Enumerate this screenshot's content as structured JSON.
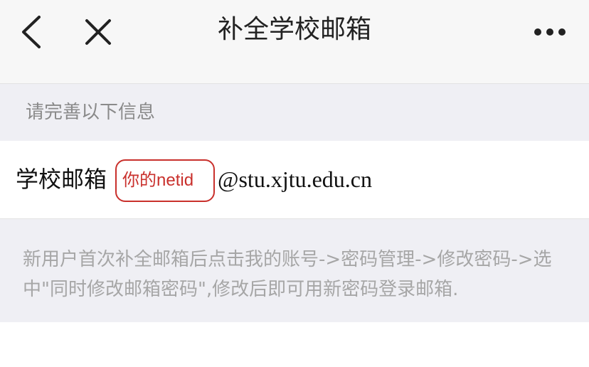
{
  "header": {
    "title": "补全学校邮箱",
    "back_icon": "chevron-left-icon",
    "close_icon": "close-icon",
    "more_icon": "more-horizontal-icon"
  },
  "form": {
    "section_header": "请完善以下信息",
    "email_label": "学校邮箱",
    "netid_placeholder": "你的netid",
    "netid_value": "",
    "email_domain": "@stu.xjtu.edu.cn"
  },
  "hint": {
    "text": "新用户首次补全邮箱后点击我的账号->密码管理->修改密码->选中\"同时修改邮箱密码\",修改后即可用新密码登录邮箱."
  },
  "colors": {
    "accent_red": "#c9302c",
    "header_bg": "#f7f7f7",
    "section_bg": "#efeff4",
    "hint_text": "#a6a6a6"
  }
}
